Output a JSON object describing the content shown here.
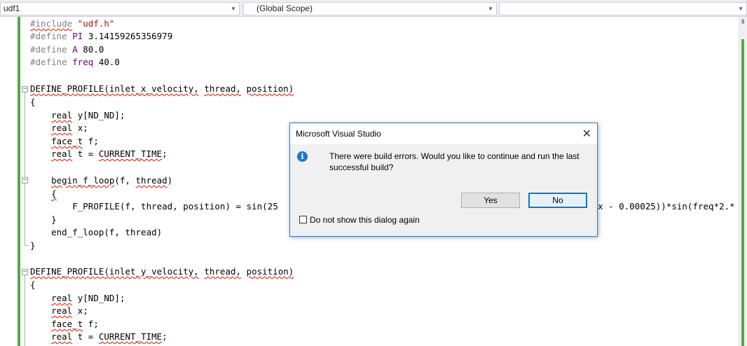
{
  "navbar": {
    "project": "udf1",
    "scope": "(Global Scope)",
    "member": ""
  },
  "code": {
    "l1": {
      "pp": "#include",
      "str": "\"udf.h\""
    },
    "l2": {
      "pp": "#define",
      "name": "PI",
      "val": "3.14159265356979"
    },
    "l3": {
      "pp": "#define",
      "name": "A",
      "val": "80.0"
    },
    "l4": {
      "pp": "#define",
      "name": "freq",
      "val": "40.0"
    },
    "l6": {
      "fn": "DEFINE_PROFILE",
      "args_a": "(inlet_x_velocity,",
      "args_b": "thread,",
      "args_c": "position)"
    },
    "l7": "{",
    "l8": {
      "kw": "real",
      "rest": " y[ND_ND];"
    },
    "l9": {
      "kw": "real",
      "rest": " x;"
    },
    "l10": {
      "kw": "face_t",
      "rest": " f;"
    },
    "l11": {
      "kw": "real",
      "rest": " t = ",
      "macro": "CURRENT_TIME",
      "end": ";"
    },
    "l13": {
      "fn": "begin_f_loop",
      "a": "(f, ",
      "b": "thread",
      "c": ")"
    },
    "l14": "{",
    "l15": "F_PROFILE(f, thread, position) = sin(25",
    "l15_tail": "x - 0.00025))*sin(freq*2.*",
    "l16": "}",
    "l17": "end_f_loop(f, thread)",
    "l18": "}",
    "l20": {
      "fn": "DEFINE_PROFILE",
      "args_a": "(inlet_y_velocity,",
      "args_b": "thread,",
      "args_c": "position)"
    },
    "l21": "{",
    "l22": {
      "kw": "real",
      "rest": " y[ND_ND];"
    },
    "l23": {
      "kw": "real",
      "rest": " x;"
    },
    "l24": {
      "kw": "face_t",
      "rest": " f;"
    },
    "l25": {
      "kw": "real",
      "rest": " t = ",
      "macro": "CURRENT_TIME",
      "end": ";"
    }
  },
  "dialog": {
    "title": "Microsoft Visual Studio",
    "message": "There were build errors. Would you like to continue and run the last successful build?",
    "yes_label": "Yes",
    "no_label": "No",
    "checkbox_label": "Do not show this dialog again",
    "checkbox_checked": false,
    "icon": "info-icon"
  },
  "colors": {
    "accent": "#0078d7",
    "change_bar": "#57a64a",
    "error_squiggle": "#e51400"
  }
}
